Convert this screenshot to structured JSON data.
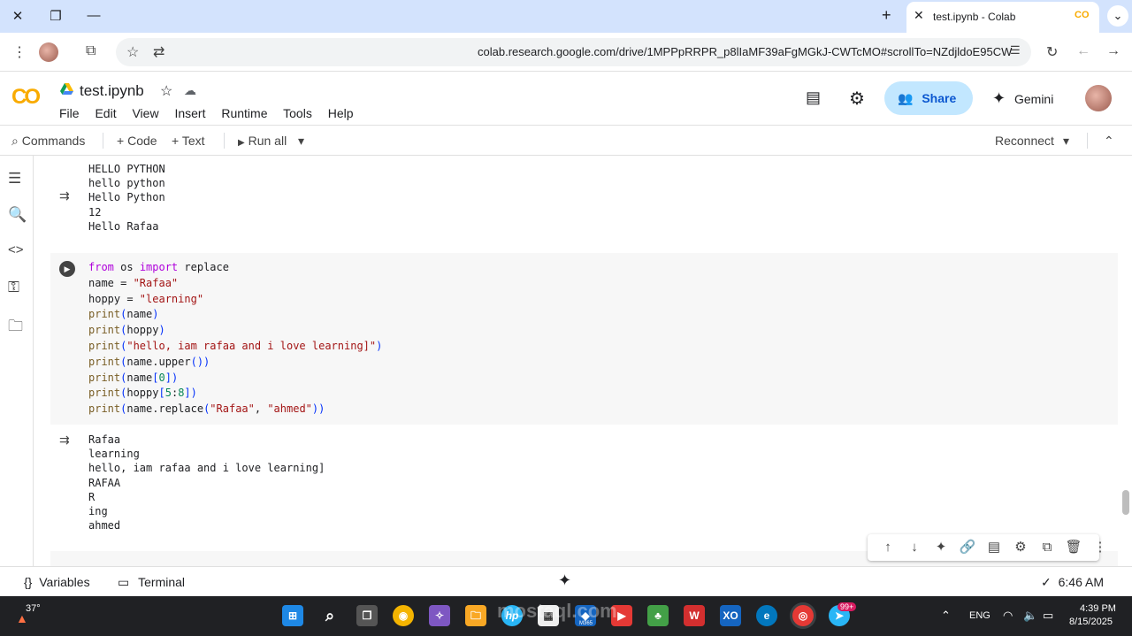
{
  "browser": {
    "tab_title": "test.ipynb - Colab",
    "tab_favicon": "CO",
    "url": "colab.research.google.com/drive/1MPPpRRPR_p8lIaMF39aFgMGkJ-CWTcMO#scrollTo=NZdjldoE95CW"
  },
  "colab": {
    "logo": "CO",
    "file_name": "test.ipynb",
    "menu": [
      "File",
      "Edit",
      "View",
      "Insert",
      "Runtime",
      "Tools",
      "Help"
    ],
    "share_label": "Share",
    "gemini_label": "Gemini"
  },
  "toolbar": {
    "commands": "Commands",
    "code": "Code",
    "text": "Text",
    "run_all": "Run all",
    "reconnect": "Reconnect"
  },
  "cells": {
    "prev_output": "HELLO PYTHON\nhello python\nHello Python\n12\nHello Rafaa",
    "cell_output": "Rafaa\nlearning\nhello, iam rafaa and i love learning]\nRAFAA\nR\ning\nahmed"
  },
  "status": {
    "variables": "Variables",
    "terminal": "Terminal",
    "time": "6:46 AM"
  },
  "taskbar": {
    "weather": "37°",
    "lang": "ENG",
    "clock_time": "4:39 PM",
    "clock_date": "8/15/2025",
    "badge": "99+",
    "m365_label": "M365"
  },
  "watermark": "mostaql.com",
  "colors": {
    "share_bg": "#c2e7ff",
    "share_text": "#0b57d0",
    "colab_orange": "#f9ab00",
    "tabbar_bg": "#d3e3fd"
  }
}
